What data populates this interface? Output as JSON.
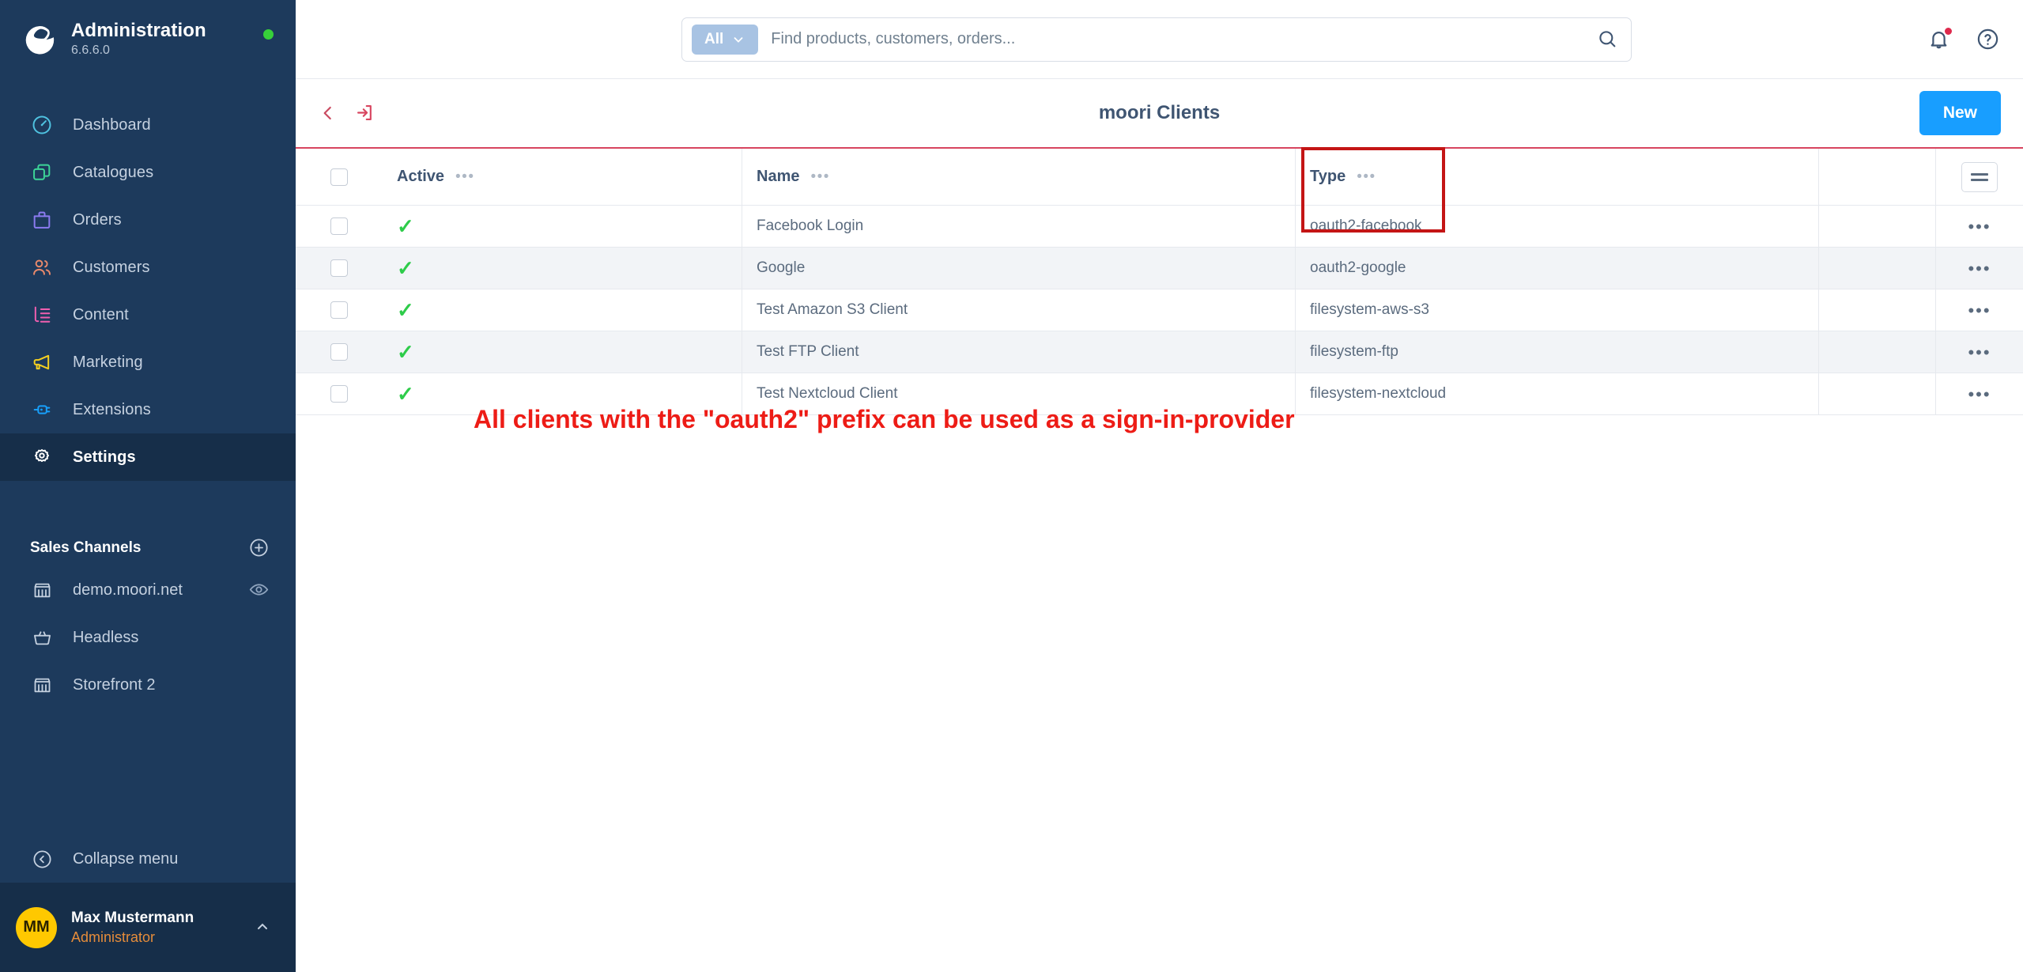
{
  "sidebar": {
    "brand": {
      "title": "Administration",
      "version": "6.6.6.0",
      "logo_icon": "shopware-logo-icon",
      "status_icon": "status-online-dot"
    },
    "nav": [
      {
        "label": "Dashboard",
        "icon": "dashboard-gauge-icon",
        "color": "#4fc2e0",
        "active": false
      },
      {
        "label": "Catalogues",
        "icon": "catalogues-layers-icon",
        "color": "#3dd598",
        "active": false
      },
      {
        "label": "Orders",
        "icon": "orders-bag-icon",
        "color": "#8b7bf0",
        "active": false
      },
      {
        "label": "Customers",
        "icon": "customers-people-icon",
        "color": "#e8896b",
        "active": false
      },
      {
        "label": "Content",
        "icon": "content-list-icon",
        "color": "#f05fb0",
        "active": false
      },
      {
        "label": "Marketing",
        "icon": "marketing-megaphone-icon",
        "color": "#f5d020",
        "active": false
      },
      {
        "label": "Extensions",
        "icon": "extensions-plug-icon",
        "color": "#18a0fb",
        "active": false
      },
      {
        "label": "Settings",
        "icon": "settings-gear-icon",
        "color": "#ffffff",
        "active": true
      }
    ],
    "sales_channels": {
      "title": "Sales Channels",
      "add_icon": "add-circle-icon",
      "items": [
        {
          "label": "demo.moori.net",
          "icon": "storefront-icon",
          "trailing_icon": "eye-icon"
        },
        {
          "label": "Headless",
          "icon": "basket-icon",
          "trailing_icon": ""
        },
        {
          "label": "Storefront 2",
          "icon": "storefront-icon",
          "trailing_icon": ""
        }
      ]
    },
    "collapse": {
      "label": "Collapse menu",
      "icon": "collapse-left-circle-icon"
    },
    "user": {
      "initials": "MM",
      "name": "Max Mustermann",
      "role": "Administrator",
      "caret_icon": "chevron-up-icon"
    }
  },
  "topbar": {
    "search": {
      "scope_label": "All",
      "scope_caret_icon": "chevron-down-icon",
      "placeholder": "Find products, customers, orders...",
      "value": "",
      "search_icon": "search-icon"
    },
    "notifications_icon": "bell-icon",
    "notifications_badge_icon": "notification-dot",
    "help_icon": "help-circle-icon"
  },
  "pagehead": {
    "back_icon": "chevron-left-icon",
    "login_icon": "sign-in-icon",
    "title": "moori Clients",
    "new_button": "New"
  },
  "table": {
    "select_all_checkbox": false,
    "columns": [
      {
        "key": "active",
        "label": "Active",
        "menu_icon": "column-menu-dots"
      },
      {
        "key": "name",
        "label": "Name",
        "menu_icon": "column-menu-dots"
      },
      {
        "key": "type",
        "label": "Type",
        "menu_icon": "column-menu-dots"
      }
    ],
    "settings_icon": "table-settings-icon",
    "row_action_icon": "row-context-dots",
    "rows": [
      {
        "active": "✓",
        "name": "Facebook Login",
        "type": "oauth2-facebook"
      },
      {
        "active": "✓",
        "name": "Google",
        "type": "oauth2-google"
      },
      {
        "active": "✓",
        "name": "Test Amazon S3 Client",
        "type": "filesystem-aws-s3"
      },
      {
        "active": "✓",
        "name": "Test FTP Client",
        "type": "filesystem-ftp"
      },
      {
        "active": "✓",
        "name": "Test Nextcloud Client",
        "type": "filesystem-nextcloud"
      }
    ]
  },
  "annotations": {
    "highlight_box_label": "oauth2-type-highlight",
    "caption": "All clients with the \"oauth2\" prefix can be used as a sign-in-provider",
    "color": "#ed1c16",
    "box_color": "#c41515"
  }
}
